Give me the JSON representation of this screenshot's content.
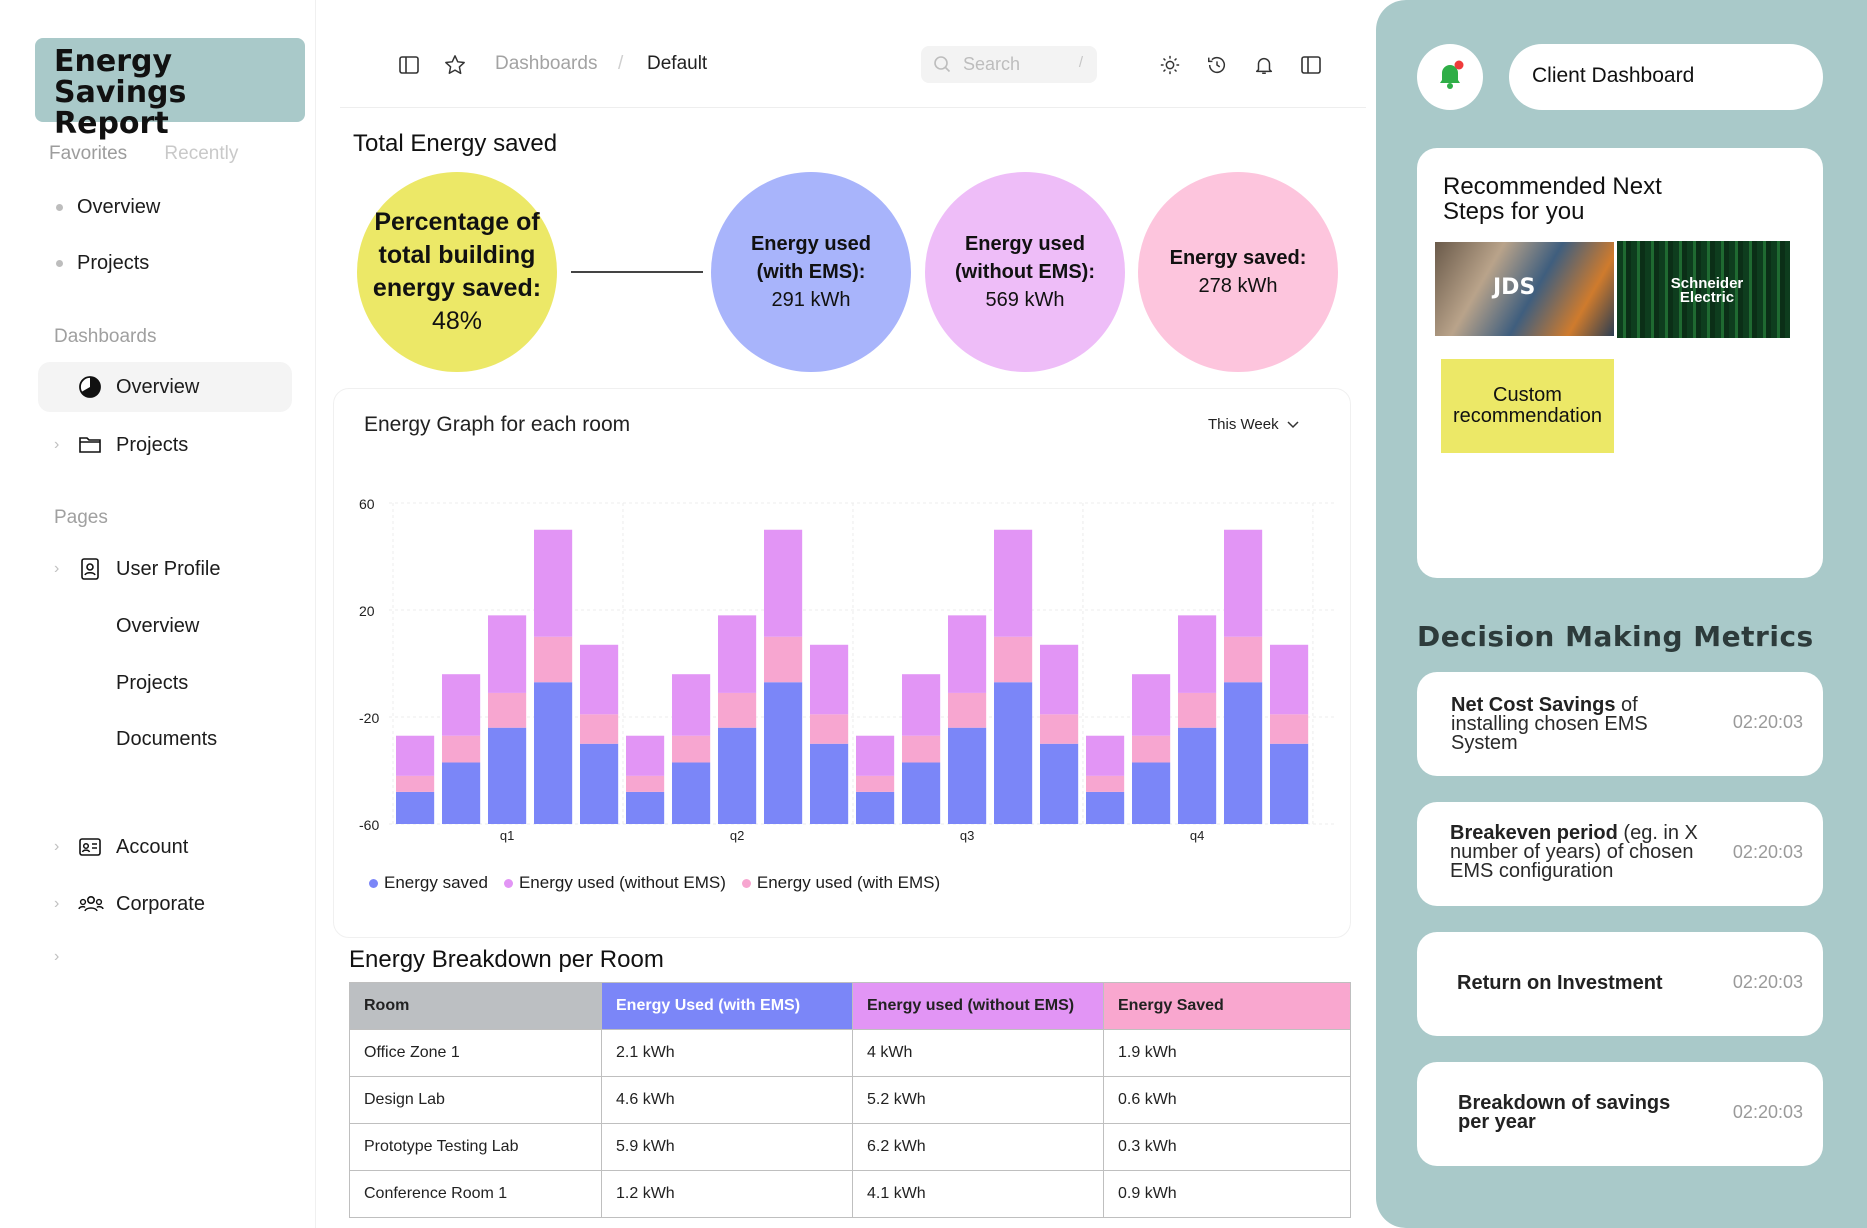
{
  "sidebar": {
    "logo": "Energy Savings Report",
    "tabs": [
      "Favorites",
      "Recently"
    ],
    "favorites": [
      "Overview",
      "Projects"
    ],
    "dashboards_label": "Dashboards",
    "dashboards": [
      {
        "label": "Overview",
        "icon": "pie-chart-icon",
        "active": true
      },
      {
        "label": "Projects",
        "icon": "folder-icon"
      }
    ],
    "pages_label": "Pages",
    "pages": [
      {
        "label": "User Profile",
        "icon": "user-badge-icon"
      },
      {
        "label": "Overview"
      },
      {
        "label": "Projects"
      },
      {
        "label": "Documents"
      },
      {
        "label": "Account",
        "icon": "id-card-icon"
      },
      {
        "label": "Corporate",
        "icon": "users-icon"
      }
    ]
  },
  "topbar": {
    "breadcrumb": [
      "Dashboards",
      "/",
      "Default"
    ],
    "search_placeholder": "Search",
    "search_shortcut": "/"
  },
  "summary": {
    "title": "Total Energy saved",
    "percentage": {
      "label": "Percentage of total building energy saved:",
      "value": "48%"
    },
    "with_ems": {
      "label": "Energy used (with EMS):",
      "value": "291 kWh"
    },
    "without_ems": {
      "label": "Energy used (without EMS):",
      "value": "569 kWh"
    },
    "saved": {
      "label": "Energy saved:",
      "value": "278 kWh"
    }
  },
  "graph": {
    "title": "Energy Graph for each room",
    "period": "This Week"
  },
  "chart_data": {
    "type": "bar",
    "stacked": true,
    "ylim": [
      -60,
      60
    ],
    "y_ticks": [
      "60",
      "20",
      "-20",
      "-60"
    ],
    "x_ticks": [
      "q1",
      "q2",
      "q3",
      "q4"
    ],
    "bars_per_group": 5,
    "series": [
      {
        "name": "Energy saved",
        "color": "#7b86f8",
        "values": [
          -48,
          -37,
          -24,
          -7,
          -30,
          -48,
          -37,
          -24,
          -7,
          -30,
          -48,
          -37,
          -24,
          -7,
          -30,
          -48,
          -37,
          -24,
          -7,
          -30
        ]
      },
      {
        "name": "Energy used (with EMS)",
        "color": "#f7a6d0",
        "values": [
          6,
          10,
          13,
          17,
          11,
          6,
          10,
          13,
          17,
          11,
          6,
          10,
          13,
          17,
          11,
          6,
          10,
          13,
          17,
          11
        ]
      },
      {
        "name": "Energy used (without EMS)",
        "color": "#e295f5",
        "values": [
          15,
          23,
          29,
          40,
          26,
          15,
          23,
          29,
          40,
          26,
          15,
          23,
          29,
          40,
          26,
          15,
          23,
          29,
          40,
          26
        ]
      }
    ],
    "grid": true,
    "legend": "bottom-left"
  },
  "legend": [
    {
      "label": "Energy saved",
      "color": "#7b86f8"
    },
    {
      "label": "Energy used (without EMS)",
      "color": "#e295f5"
    },
    {
      "label": "Energy used (with EMS)",
      "color": "#f7a6d0"
    }
  ],
  "breakdown": {
    "title": "Energy Breakdown per Room",
    "headers": [
      "Room",
      "Energy Used (with EMS)",
      "Energy used (without EMS)",
      "Energy Saved"
    ],
    "header_colors": [
      "#bcbfc2",
      "#7b86f8",
      "#e295f5",
      "#f9a7cf"
    ],
    "rows": [
      [
        "Office Zone 1",
        "2.1 kWh",
        "4 kWh",
        "1.9 kWh"
      ],
      [
        "Design Lab",
        "4.6 kWh",
        "5.2 kWh",
        "0.6 kWh"
      ],
      [
        "Prototype Testing Lab",
        "5.9 kWh",
        "6.2 kWh",
        "0.3 kWh"
      ],
      [
        "Conference Room 1",
        "1.2 kWh",
        "4.1 kWh",
        "0.9 kWh"
      ]
    ]
  },
  "right": {
    "client_dashboard": "Client Dashboard",
    "recommended_title": "Recommended Next Steps for you",
    "rec_images": [
      "JDS",
      "Schneider Electric"
    ],
    "custom_recommendation": "Custom recommendation",
    "metrics_title": "Decision Making Metrics",
    "metrics": [
      {
        "bold": "Net Cost Savings",
        "rest": " of installing chosen EMS System",
        "time": "02:20:03"
      },
      {
        "bold": "Breakeven period",
        "rest": " (eg. in X number of years) of chosen EMS configuration",
        "time": "02:20:03"
      },
      {
        "bold": "Return on Investment",
        "rest": "",
        "time": "02:20:03"
      },
      {
        "bold": "Breakdown of savings per year",
        "rest": "",
        "time": "02:20:03"
      }
    ]
  }
}
